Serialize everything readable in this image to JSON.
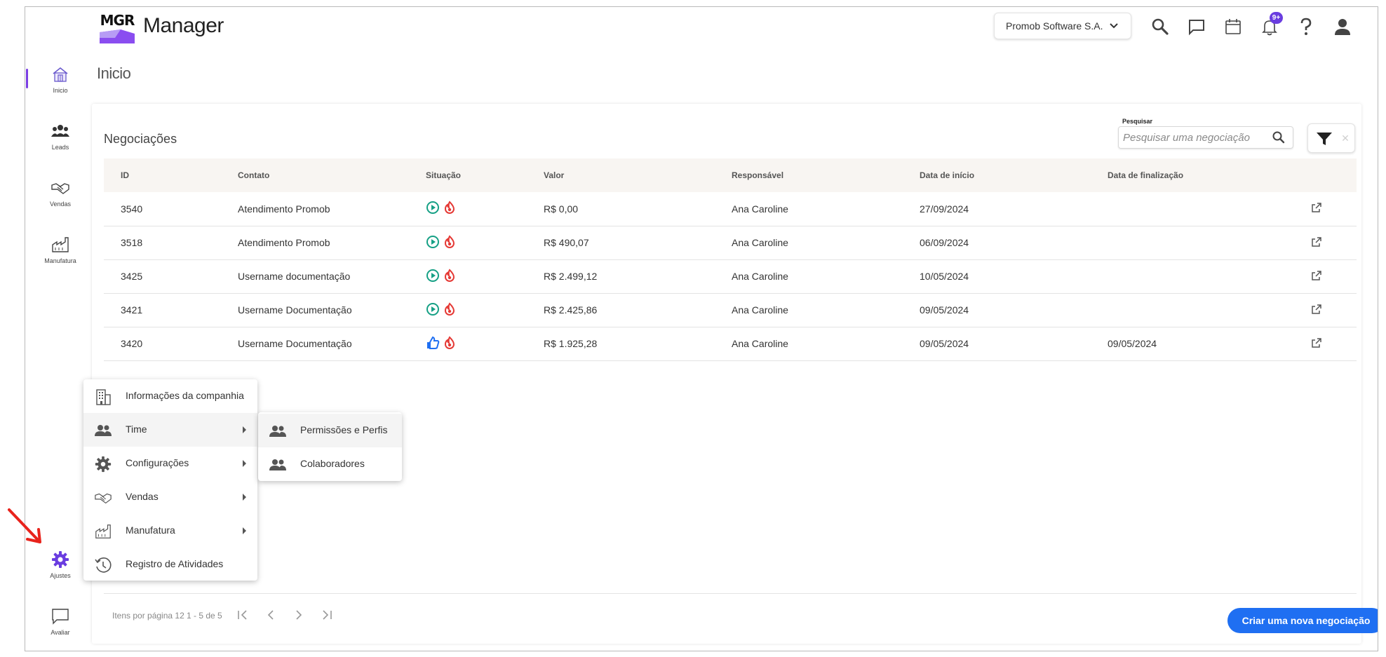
{
  "app": {
    "logo_text": "MGR",
    "title": "Manager"
  },
  "header": {
    "company": "Promob Software S.A.",
    "notification_badge": "9+",
    "icons": [
      "search-icon",
      "chat-icon",
      "calendar-icon",
      "bell-icon",
      "help-icon",
      "user-icon"
    ]
  },
  "sidebar": {
    "items": [
      {
        "label": "Inicio",
        "icon": "home-icon",
        "active": true
      },
      {
        "label": "Leads",
        "icon": "people-icon"
      },
      {
        "label": "Vendas",
        "icon": "handshake-icon"
      },
      {
        "label": "Manufatura",
        "icon": "factory-icon"
      },
      {
        "label": "Ajustes",
        "icon": "gear-icon"
      },
      {
        "label": "Avaliar",
        "icon": "feedback-icon"
      }
    ]
  },
  "page": {
    "title": "Inicio"
  },
  "negociacoes": {
    "title": "Negociações",
    "search": {
      "label": "Pesquisar",
      "placeholder": "Pesquisar uma negociação"
    },
    "columns": [
      "ID",
      "Contato",
      "Situação",
      "Valor",
      "Responsável",
      "Data de início",
      "Data de finalização"
    ],
    "rows": [
      {
        "id": "3540",
        "contato": "Atendimento Promob",
        "situacao": "em-andamento",
        "valor": "R$ 0,00",
        "responsavel": "Ana Caroline",
        "inicio": "27/09/2024",
        "fim": ""
      },
      {
        "id": "3518",
        "contato": "Atendimento Promob",
        "situacao": "em-andamento",
        "valor": "R$ 490,07",
        "responsavel": "Ana Caroline",
        "inicio": "06/09/2024",
        "fim": ""
      },
      {
        "id": "3425",
        "contato": "Username documentação",
        "situacao": "em-andamento",
        "valor": "R$ 2.499,12",
        "responsavel": "Ana Caroline",
        "inicio": "10/05/2024",
        "fim": ""
      },
      {
        "id": "3421",
        "contato": "Username Documentação",
        "situacao": "em-andamento",
        "valor": "R$ 2.425,86",
        "responsavel": "Ana Caroline",
        "inicio": "09/05/2024",
        "fim": ""
      },
      {
        "id": "3420",
        "contato": "Username Documentação",
        "situacao": "ganha",
        "valor": "R$ 1.925,28",
        "responsavel": "Ana Caroline",
        "inicio": "09/05/2024",
        "fim": "09/05/2024"
      }
    ],
    "footer": {
      "items_per_page": "Itens por página 12",
      "range": "1 - 5 de 5"
    },
    "create_button": "Criar uma nova negociação"
  },
  "settings_menu": {
    "items": [
      {
        "label": "Informações da companhia",
        "icon": "building-icon",
        "submenu": false
      },
      {
        "label": "Time",
        "icon": "people-icon",
        "submenu": true,
        "hover": true
      },
      {
        "label": "Configurações",
        "icon": "gear-icon",
        "submenu": true
      },
      {
        "label": "Vendas",
        "icon": "handshake-icon",
        "submenu": true
      },
      {
        "label": "Manufatura",
        "icon": "factory-icon",
        "submenu": true
      },
      {
        "label": "Registro de Atividades",
        "icon": "history-icon",
        "submenu": false
      }
    ],
    "time_submenu": [
      {
        "label": "Permissões e Perfis",
        "icon": "people-icon",
        "hover": true
      },
      {
        "label": "Colaboradores",
        "icon": "people-icon"
      }
    ]
  },
  "colors": {
    "accent": "#7b3fe4",
    "primary": "#1f6ff2",
    "green": "#16a085",
    "red": "#e53935",
    "blue": "#1f6ff2",
    "arrow": "#e8231c"
  }
}
